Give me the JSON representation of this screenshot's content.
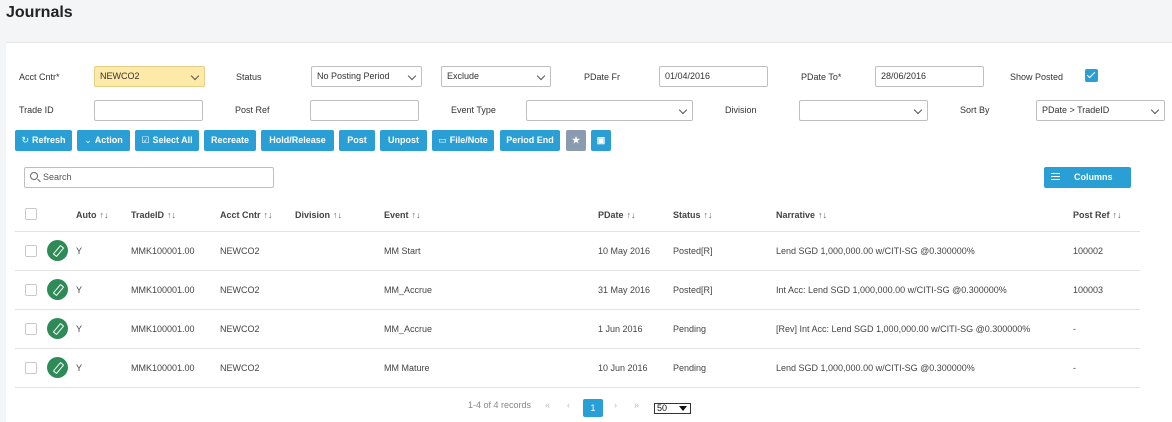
{
  "page": {
    "title": "Journals"
  },
  "filters": {
    "acct_cntr_label": "Acct Cntr*",
    "acct_cntr_value": "NEWCO2",
    "status_label": "Status",
    "status_value": "No Posting Period",
    "exclude_value": "Exclude",
    "pdate_fr_label": "PDate Fr",
    "pdate_fr_value": "01/04/2016",
    "pdate_to_label": "PDate To*",
    "pdate_to_value": "28/06/2016",
    "show_posted_label": "Show Posted",
    "show_posted_checked": true,
    "trade_id_label": "Trade ID",
    "trade_id_value": "",
    "post_ref_label": "Post Ref",
    "post_ref_value": "",
    "event_type_label": "Event Type",
    "event_type_value": "",
    "division_label": "Division",
    "division_value": "",
    "sort_by_label": "Sort By",
    "sort_by_value": "PDate > TradeID"
  },
  "toolbar": {
    "refresh": "Refresh",
    "action": "Action",
    "select_all": "Select All",
    "recreate": "Recreate",
    "hold_release": "Hold/Release",
    "post": "Post",
    "unpost": "Unpost",
    "file_note": "File/Note",
    "period_end": "Period End",
    "favorite_icon": "star-icon",
    "save_icon": "save-icon"
  },
  "grid": {
    "search_placeholder": "Search",
    "columns_button": "Columns",
    "headers": {
      "auto": "Auto",
      "trade_id": "TradeID",
      "acct_cntr": "Acct Cntr",
      "division": "Division",
      "event": "Event",
      "pdate": "PDate",
      "status": "Status",
      "narrative": "Narrative",
      "post_ref": "Post Ref"
    },
    "sort_glyph": "↑↓",
    "rows": [
      {
        "auto": "Y",
        "trade_id": "MMK100001.00",
        "acct_cntr": "NEWCO2",
        "division": "",
        "event": "MM Start",
        "pdate": "10 May 2016",
        "status": "Posted[R]",
        "narrative": "Lend SGD 1,000,000.00 w/CITI-SG @0.300000%",
        "post_ref": "100002"
      },
      {
        "auto": "Y",
        "trade_id": "MMK100001.00",
        "acct_cntr": "NEWCO2",
        "division": "",
        "event": "MM_Accrue",
        "pdate": "31 May 2016",
        "status": "Posted[R]",
        "narrative": "Int Acc: Lend SGD 1,000,000.00 w/CITI-SG @0.300000%",
        "post_ref": "100003"
      },
      {
        "auto": "Y",
        "trade_id": "MMK100001.00",
        "acct_cntr": "NEWCO2",
        "division": "",
        "event": "MM_Accrue",
        "pdate": "1 Jun 2016",
        "status": "Pending",
        "narrative": "[Rev] Int Acc: Lend SGD 1,000,000.00 w/CITI-SG @0.300000%",
        "post_ref": "-"
      },
      {
        "auto": "Y",
        "trade_id": "MMK100001.00",
        "acct_cntr": "NEWCO2",
        "division": "",
        "event": "MM Mature",
        "pdate": "10 Jun 2016",
        "status": "Pending",
        "narrative": "Lend SGD 1,000,000.00 w/CITI-SG @0.300000%",
        "post_ref": "-"
      }
    ]
  },
  "pagination": {
    "summary": "1-4 of 4 records",
    "first": "«",
    "prev": "‹",
    "current_page": "1",
    "next": "›",
    "last": "»",
    "page_size": "50"
  },
  "colors": {
    "accent": "#2a9fd6",
    "edit": "#2e8b57",
    "highlight_field": "#fde9a8"
  }
}
